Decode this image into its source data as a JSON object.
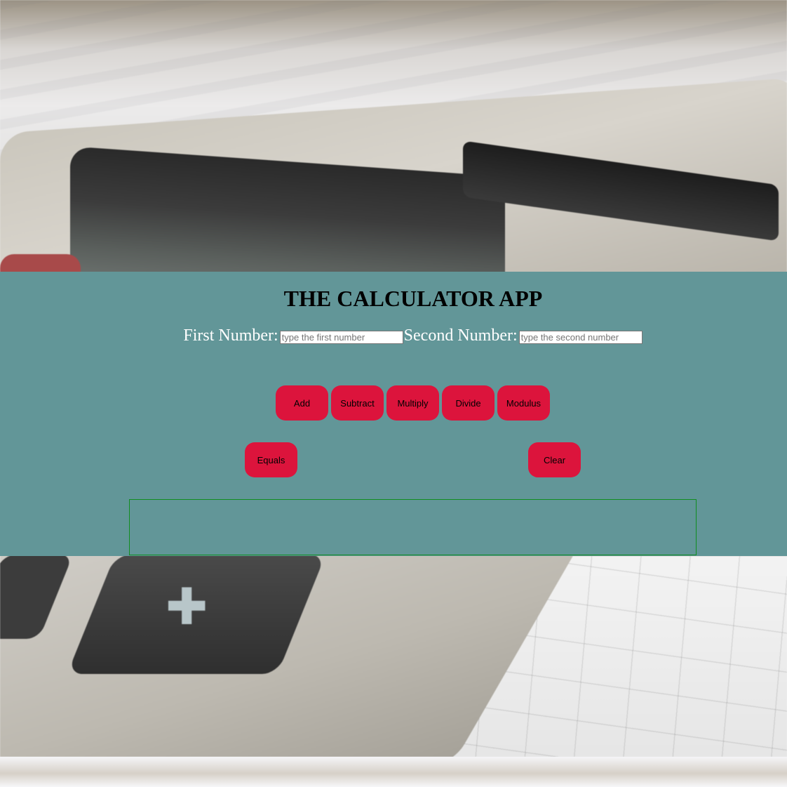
{
  "app": {
    "title": "THE CALCULATOR APP"
  },
  "inputs": {
    "first_label": "First Number:",
    "first_placeholder": "type the first number",
    "first_value": "",
    "second_label": "Second Number:",
    "second_placeholder": "type the second number",
    "second_value": ""
  },
  "operations": [
    {
      "label": "Add"
    },
    {
      "label": "Subtract"
    },
    {
      "label": "Multiply"
    },
    {
      "label": "Divide"
    },
    {
      "label": "Modulus"
    }
  ],
  "actions": {
    "equals_label": "Equals",
    "clear_label": "Clear"
  },
  "result": {
    "text": ""
  },
  "colors": {
    "panel_bg": "#629698",
    "button_bg": "#dc143c",
    "result_border": "#108d20",
    "label_text": "#ffffff"
  }
}
